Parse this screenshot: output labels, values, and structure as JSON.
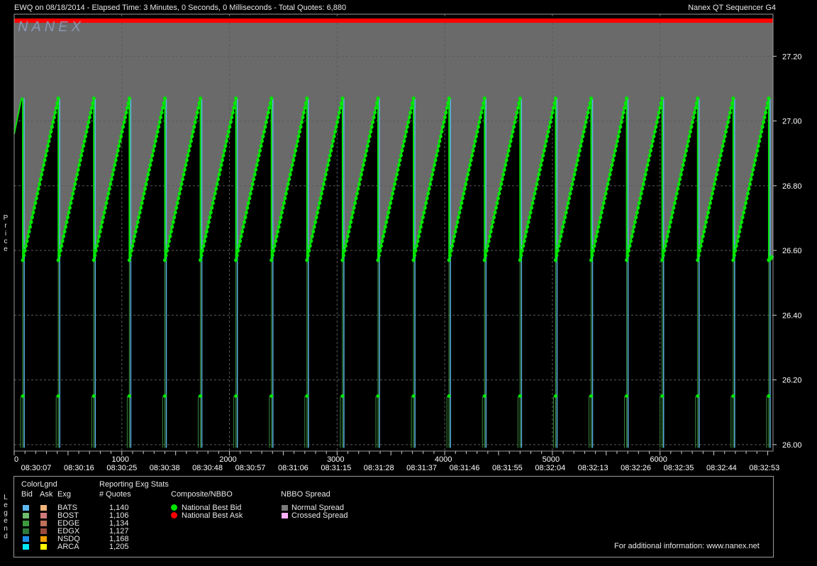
{
  "header": {
    "left": "EWQ on 08/18/2014  -  Elapsed Time: 3 Minutes, 0 Seconds, 0 Milliseconds  -  Total Quotes: 6,880",
    "right": "Nanex QT Sequencer G4"
  },
  "watermark": "NANEX",
  "side_labels": {
    "price": "Price",
    "legend": "Legend"
  },
  "colors": {
    "background": "#000000",
    "spread_fill": "#6a6a6a",
    "best_ask_line": "#ff0000",
    "best_bid": "#00e600",
    "bid_line": "#5ab4e6",
    "low_bid_line": "#3a8a3a",
    "grid": "#5a5a5a",
    "axis_text": "#ffffff"
  },
  "chart_data": {
    "type": "line",
    "title": "",
    "xlabel": "",
    "ylabel": "Price",
    "xlim": [
      0,
      7050
    ],
    "ylim": [
      25.98,
      27.33
    ],
    "grid": true,
    "y_ticks": [
      26.0,
      26.2,
      26.4,
      26.6,
      26.8,
      27.0,
      27.2
    ],
    "y_tick_labels": [
      "26.00",
      "26.20",
      "26.40",
      "26.60",
      "26.80",
      "27.00",
      "27.20"
    ],
    "x_ticks": [
      0,
      1000,
      2000,
      3000,
      4000,
      5000,
      6000
    ],
    "x_tick_labels": [
      "0",
      "1000",
      "2000",
      "3000",
      "4000",
      "5000",
      "6000"
    ],
    "time_labels": [
      "08:30:07",
      "08:30:16",
      "08:30:25",
      "08:30:38",
      "08:30:48",
      "08:30:57",
      "08:31:06",
      "08:31:15",
      "08:31:28",
      "08:31:37",
      "08:31:46",
      "08:31:55",
      "08:32:04",
      "08:32:13",
      "08:32:26",
      "08:32:35",
      "08:32:44",
      "08:32:53"
    ],
    "national_best_ask": 27.31,
    "sawtooth": {
      "cycles": 22,
      "first_reset_quote": 80,
      "cycle_quotes": 330,
      "bid_start": 26.57,
      "bid_peak": 27.07,
      "low_bid": 26.15,
      "floor": 25.99
    },
    "series": [
      {
        "name": "National Best Bid",
        "values": "sawtooth 26.57 → 27.07, 22 cycles"
      },
      {
        "name": "National Best Ask",
        "values": "flat 27.31"
      }
    ]
  },
  "legend": {
    "colorlgnd_title": "ColorLgnd",
    "col_bid": "Bid",
    "col_ask": "Ask",
    "col_exg": "Exg",
    "reporting_title": "Reporting Exg Stats",
    "quotes_title": "# Quotes",
    "exchanges": [
      {
        "name": "BATS",
        "quotes": "1,140",
        "bid_color": "#5fb9f0",
        "ask_color": "#f0b478"
      },
      {
        "name": "BOST",
        "quotes": "1,106",
        "bid_color": "#6dbb6d",
        "ask_color": "#d27a7a"
      },
      {
        "name": "EDGE",
        "quotes": "1,134",
        "bid_color": "#3c9a3c",
        "ask_color": "#c0705a"
      },
      {
        "name": "EDGX",
        "quotes": "1,127",
        "bid_color": "#2f7a3a",
        "ask_color": "#9a4a3a"
      },
      {
        "name": "NSDQ",
        "quotes": "1,168",
        "bid_color": "#1e8fe6",
        "ask_color": "#f0a000"
      },
      {
        "name": "ARCA",
        "quotes": "1,205",
        "bid_color": "#00e6f0",
        "ask_color": "#ffff00"
      }
    ],
    "composite_title": "Composite/NBBO",
    "nbb_label": "National Best Bid",
    "nbo_label": "National Best Ask",
    "spread_title": "NBBO Spread",
    "normal_spread": "Normal Spread",
    "crossed_spread": "Crossed Spread",
    "normal_color": "#7a7a7a",
    "crossed_color": "#ffb0ff",
    "footer": "For additional information: www.nanex.net"
  }
}
